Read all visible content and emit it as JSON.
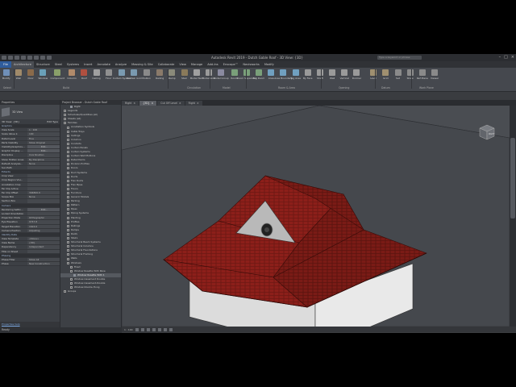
{
  "app": {
    "title": "Autodesk Revit 2019 - Dutch Gable Roof - 3D View: {3D}",
    "search_placeholder": "Type a keyword or phrase"
  },
  "menu_tabs": [
    "File",
    "Architecture",
    "Structure",
    "Steel",
    "Systems",
    "Insert",
    "Annotate",
    "Analyze",
    "Massing & Site",
    "Collaborate",
    "View",
    "Manage",
    "Add-Ins",
    "Enscape™",
    "Navisworks",
    "Modify"
  ],
  "ribbon": {
    "buttons": [
      "Modify",
      "Wall",
      "Door",
      "Window",
      "Component",
      "Column",
      "Roof",
      "Ceiling",
      "Floor",
      "Curtain System",
      "Curtain Grid",
      "Mullion",
      "Railing",
      "Ramp",
      "Stair",
      "Model Text",
      "Model Line",
      "Model Group",
      "Room",
      "Room Separator",
      "Tag Room",
      "Area",
      "Area Boundary",
      "Tag Area",
      "By Face",
      "Shaft",
      "Wall",
      "Vertical",
      "Dormer",
      "Level",
      "Grid",
      "Set",
      "Show",
      "Ref Plane",
      "Viewer"
    ],
    "groups": [
      "Select",
      "Build",
      "Circulation",
      "Model",
      "Room & Area",
      "Opening",
      "Datum",
      "Work Plane"
    ]
  },
  "view_tabs": [
    {
      "label": "Right",
      "active": false
    },
    {
      "label": "{3D}",
      "active": true
    },
    {
      "label": "Cut Off Level",
      "active": false
    },
    {
      "label": "Right",
      "active": false
    }
  ],
  "properties": {
    "title": "Properties",
    "type": "3D View",
    "filter_label": "3D View: {3D}",
    "edit_type": "Edit Type",
    "sections": [
      {
        "name": "Graphics",
        "rows": [
          [
            "View Scale",
            "1 : 100"
          ],
          [
            "Scale Value 1:",
            "100"
          ],
          [
            "Detail Level",
            "Fine"
          ],
          [
            "Parts Visibility",
            "Show Original"
          ],
          [
            "Visibility/Graphics...",
            "Edit..."
          ],
          [
            "Graphic Display ...",
            "Edit..."
          ],
          [
            "Discipline",
            "Coordination"
          ],
          [
            "Show Hidden Lines",
            "By Discipline"
          ],
          [
            "Default Analysis...",
            "None"
          ],
          [
            "Sun Path",
            ""
          ]
        ]
      },
      {
        "name": "Extents",
        "rows": [
          [
            "Crop View",
            ""
          ],
          [
            "Crop Region Visi...",
            ""
          ],
          [
            "Annotation Crop",
            ""
          ],
          [
            "Far Clip Active",
            ""
          ],
          [
            "Far Clip Offset",
            "304800.0"
          ],
          [
            "Scope Box",
            "None"
          ],
          [
            "Section Box",
            ""
          ]
        ]
      },
      {
        "name": "Camera",
        "rows": [
          [
            "Rendering Settin...",
            "Edit..."
          ],
          [
            "Locked Orientation",
            ""
          ],
          [
            "Projection Mode",
            "Orthographic"
          ],
          [
            "Eye Elevation",
            "9747.8"
          ],
          [
            "Target Elevation",
            "1624.6"
          ],
          [
            "Camera Position",
            "Adjusting"
          ]
        ]
      },
      {
        "name": "Identity Data",
        "rows": [
          [
            "View Template",
            "<None>"
          ],
          [
            "View Name",
            "{3D}"
          ],
          [
            "Dependency",
            "Independent"
          ],
          [
            "Title on Sheet",
            ""
          ]
        ]
      },
      {
        "name": "Phasing",
        "rows": [
          [
            "Phase Filter",
            "Show All"
          ],
          [
            "Phase",
            "New Construction"
          ]
        ]
      }
    ],
    "help_link": "Properties help",
    "apply": "Apply"
  },
  "browser": {
    "title": "Project Browser - Dutch Gable Roof",
    "items": [
      {
        "label": "Right",
        "indent": 3,
        "kind": "leaf"
      },
      {
        "label": "Legends",
        "indent": 1,
        "kind": "node"
      },
      {
        "label": "Schedules/Quantities (all)",
        "indent": 1,
        "kind": "node"
      },
      {
        "label": "Sheets (all)",
        "indent": 1,
        "kind": "node"
      },
      {
        "label": "Families",
        "indent": 1,
        "kind": "node"
      },
      {
        "label": "Annotation Symbols",
        "indent": 2,
        "kind": "node"
      },
      {
        "label": "Cable Trays",
        "indent": 2,
        "kind": "node"
      },
      {
        "label": "Ceilings",
        "indent": 2,
        "kind": "node"
      },
      {
        "label": "Columns",
        "indent": 2,
        "kind": "node"
      },
      {
        "label": "Conduits",
        "indent": 2,
        "kind": "node"
      },
      {
        "label": "Curtain Panels",
        "indent": 2,
        "kind": "node"
      },
      {
        "label": "Curtain Systems",
        "indent": 2,
        "kind": "node"
      },
      {
        "label": "Curtain Wall Mullions",
        "indent": 2,
        "kind": "node"
      },
      {
        "label": "Detail Items",
        "indent": 2,
        "kind": "node"
      },
      {
        "label": "Division Profiles",
        "indent": 2,
        "kind": "node"
      },
      {
        "label": "Doors",
        "indent": 2,
        "kind": "node"
      },
      {
        "label": "Duct Systems",
        "indent": 2,
        "kind": "node"
      },
      {
        "label": "Ducts",
        "indent": 2,
        "kind": "node"
      },
      {
        "label": "Flex Ducts",
        "indent": 2,
        "kind": "node"
      },
      {
        "label": "Flex Pipes",
        "indent": 2,
        "kind": "node"
      },
      {
        "label": "Floors",
        "indent": 2,
        "kind": "node"
      },
      {
        "label": "Furniture",
        "indent": 2,
        "kind": "node"
      },
      {
        "label": "Generic Models",
        "indent": 2,
        "kind": "node"
      },
      {
        "label": "Parking",
        "indent": 2,
        "kind": "node"
      },
      {
        "label": "Pattern",
        "indent": 2,
        "kind": "node"
      },
      {
        "label": "Pipes",
        "indent": 2,
        "kind": "node"
      },
      {
        "label": "Piping Systems",
        "indent": 2,
        "kind": "node"
      },
      {
        "label": "Planting",
        "indent": 2,
        "kind": "node"
      },
      {
        "label": "Profiles",
        "indent": 2,
        "kind": "node"
      },
      {
        "label": "Railings",
        "indent": 2,
        "kind": "node"
      },
      {
        "label": "Ramps",
        "indent": 2,
        "kind": "node"
      },
      {
        "label": "Roofs",
        "indent": 2,
        "kind": "node"
      },
      {
        "label": "Stairs",
        "indent": 2,
        "kind": "node"
      },
      {
        "label": "Structural Beam Systems",
        "indent": 2,
        "kind": "node"
      },
      {
        "label": "Structural Columns",
        "indent": 2,
        "kind": "node"
      },
      {
        "label": "Structural Foundations",
        "indent": 2,
        "kind": "node"
      },
      {
        "label": "Structural Framing",
        "indent": 2,
        "kind": "node"
      },
      {
        "label": "Walls",
        "indent": 2,
        "kind": "node"
      },
      {
        "label": "Windows",
        "indent": 2,
        "kind": "node"
      },
      {
        "label": "Fixed",
        "indent": 3,
        "kind": "node"
      },
      {
        "label": "Window Rosette With Pane",
        "indent": 3,
        "kind": "node"
      },
      {
        "label": "Window Rosette With 1",
        "indent": 4,
        "kind": "leaf",
        "selected": true
      },
      {
        "label": "Window-Casement Double",
        "indent": 3,
        "kind": "node"
      },
      {
        "label": "Window-Casement-Double",
        "indent": 3,
        "kind": "node"
      },
      {
        "label": "Window-Double-Hung",
        "indent": 3,
        "kind": "node"
      },
      {
        "label": "Groups",
        "indent": 1,
        "kind": "node"
      }
    ]
  },
  "viewcube": {
    "face": "RIGHT"
  },
  "view_control": {
    "scale": "1 : 100"
  },
  "status": "Ready",
  "colors": {
    "roof": "#8c1f1a",
    "wall": "#e6e6e6",
    "background": "#4a4d52",
    "file_tab": "#2f5c9c"
  }
}
